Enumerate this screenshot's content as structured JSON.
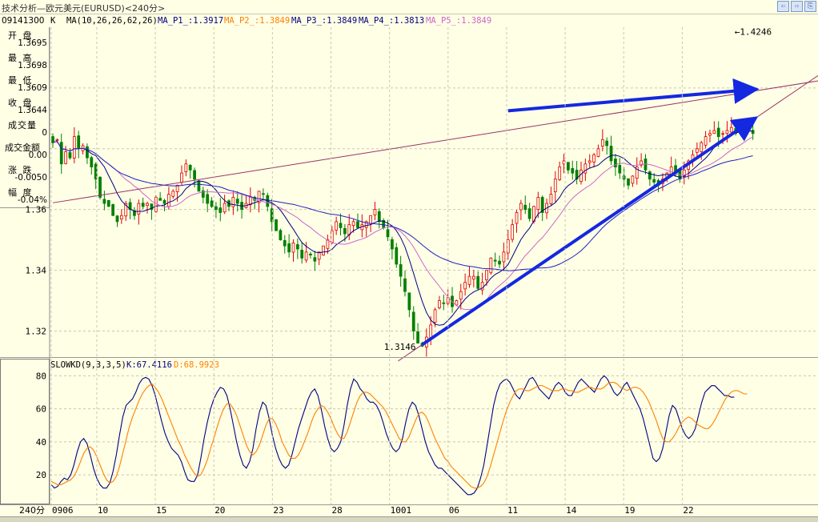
{
  "window": {
    "title": "技术分析—欧元美元(EURUSD)<240分>",
    "buttons": [
      "⇦",
      "⇨",
      "⎘"
    ]
  },
  "info": {
    "code": "09141300",
    "k_label": "K",
    "ma_params": "MA(10,26,26,62,26)",
    "ma": [
      {
        "label": "MA_P1_:1.3917",
        "color": "#000080"
      },
      {
        "label": "MA_P2_:1.3849",
        "color": "#ff8000"
      },
      {
        "label": "MA_P3_:1.3849",
        "color": "#000080"
      },
      {
        "label": "MA_P4_:1.3813",
        "color": "#000080"
      },
      {
        "label": "MA_P5_:1.3849",
        "color": "#cc66cc"
      }
    ]
  },
  "panel": [
    {
      "label": "开 盘",
      "value": "1.3695",
      "color": "#e00000"
    },
    {
      "label": "最 高",
      "value": "1.3698",
      "color": "#e00000"
    },
    {
      "label": "最 低",
      "value": "1.3609",
      "color": "#008000"
    },
    {
      "label": "收 盘",
      "value": "1.3644",
      "color": "#008000"
    },
    {
      "label": "成交量",
      "value": "0",
      "color": "#000000"
    },
    {
      "label": "成交金额",
      "value": "0.00",
      "color": "#000000"
    },
    {
      "label": "涨 跌",
      "value": "-0.0050",
      "color": "#008000"
    },
    {
      "label": "幅 度",
      "value": "-0.04%",
      "color": "#008000"
    }
  ],
  "chart_data": [
    {
      "type": "candlestick",
      "y_ticks": [
        "1.36",
        "1.34",
        "1.32"
      ],
      "ylim": [
        1.313,
        1.42
      ],
      "annotations": [
        {
          "text": "←1.4246",
          "at": "period high"
        },
        {
          "text": "1.3146",
          "at": "period low"
        }
      ],
      "trend_lines": [
        {
          "name": "resistance",
          "from": [
            0,
            1.3622
          ],
          "to": [
            170,
            1.4005
          ]
        },
        {
          "name": "upper arrow",
          "from": [
            106,
            1.3925
          ],
          "to": [
            163,
            1.3995
          ]
        },
        {
          "name": "lower arrow",
          "from": [
            86,
            1.3155
          ],
          "to": [
            163,
            1.3895
          ]
        }
      ],
      "close": [
        1.382,
        1.383,
        1.375,
        1.379,
        1.377,
        1.384,
        1.38,
        1.381,
        1.377,
        1.374,
        1.37,
        1.364,
        1.362,
        1.361,
        1.358,
        1.356,
        1.358,
        1.362,
        1.36,
        1.358,
        1.362,
        1.361,
        1.362,
        1.36,
        1.364,
        1.363,
        1.362,
        1.365,
        1.366,
        1.368,
        1.372,
        1.375,
        1.373,
        1.37,
        1.366,
        1.364,
        1.362,
        1.361,
        1.36,
        1.359,
        1.362,
        1.361,
        1.364,
        1.362,
        1.36,
        1.362,
        1.364,
        1.363,
        1.366,
        1.365,
        1.361,
        1.356,
        1.353,
        1.35,
        1.348,
        1.346,
        1.349,
        1.347,
        1.344,
        1.346,
        1.345,
        1.343,
        1.346,
        1.348,
        1.35,
        1.353,
        1.356,
        1.354,
        1.352,
        1.355,
        1.356,
        1.354,
        1.355,
        1.356,
        1.358,
        1.36,
        1.356,
        1.354,
        1.351,
        1.347,
        1.342,
        1.338,
        1.333,
        1.327,
        1.32,
        1.316,
        1.315,
        1.318,
        1.322,
        1.327,
        1.33,
        1.329,
        1.331,
        1.328,
        1.33,
        1.333,
        1.336,
        1.338,
        1.338,
        1.334,
        1.336,
        1.34,
        1.344,
        1.343,
        1.342,
        1.346,
        1.35,
        1.355,
        1.359,
        1.362,
        1.36,
        1.357,
        1.361,
        1.364,
        1.359,
        1.362,
        1.365,
        1.37,
        1.374,
        1.376,
        1.373,
        1.372,
        1.37,
        1.373,
        1.375,
        1.376,
        1.378,
        1.38,
        1.383,
        1.381,
        1.376,
        1.374,
        1.372,
        1.37,
        1.368,
        1.371,
        1.374,
        1.376,
        1.373,
        1.37,
        1.369,
        1.368,
        1.37,
        1.372,
        1.374,
        1.372,
        1.37,
        1.373,
        1.376,
        1.378,
        1.38,
        1.382,
        1.384,
        1.385,
        1.386,
        1.384,
        1.385,
        1.386,
        1.387,
        1.385,
        1.386,
        1.387,
        1.386,
        1.385
      ],
      "ma_lines": [
        {
          "name": "MA_P1_",
          "color": "#000080",
          "window": 8
        },
        {
          "name": "MA_P5_",
          "color": "#cc66cc",
          "window": 16
        },
        {
          "name": "MA_P4_",
          "color": "#2020c0",
          "window": 40
        }
      ]
    },
    {
      "type": "line",
      "title": "SLOWKD(9,3,3,5)",
      "legend": [
        {
          "label": "K:67.4116",
          "color": "#000080"
        },
        {
          "label": "D:68.9923",
          "color": "#ff8000"
        }
      ],
      "y_ticks": [
        "80",
        "60",
        "40",
        "20"
      ],
      "ylim": [
        5,
        85
      ],
      "x_ticks": [
        "0906",
        "10",
        "15",
        "20",
        "23",
        "28",
        "1001",
        "06",
        "11",
        "14",
        "19",
        "22"
      ],
      "x_tick_index": [
        0,
        14,
        32,
        50,
        68,
        86,
        104,
        122,
        140,
        158,
        176,
        194
      ],
      "n": 220,
      "series": [
        {
          "name": "K",
          "color": "#000080",
          "values": [
            14,
            12,
            13,
            16,
            18,
            17,
            20,
            26,
            34,
            40,
            42,
            39,
            32,
            24,
            18,
            14,
            12,
            12,
            15,
            22,
            32,
            44,
            55,
            62,
            64,
            66,
            70,
            75,
            78,
            79,
            78,
            74,
            68,
            60,
            52,
            45,
            40,
            36,
            34,
            32,
            28,
            22,
            17,
            16,
            16,
            20,
            30,
            42,
            52,
            60,
            66,
            70,
            73,
            72,
            68,
            60,
            50,
            40,
            32,
            26,
            24,
            28,
            36,
            48,
            58,
            64,
            62,
            54,
            44,
            36,
            30,
            26,
            24,
            26,
            32,
            40,
            48,
            54,
            60,
            66,
            70,
            72,
            68,
            60,
            50,
            42,
            36,
            34,
            36,
            40,
            50,
            62,
            72,
            78,
            76,
            72,
            70,
            66,
            64,
            64,
            62,
            58,
            52,
            45,
            40,
            36,
            34,
            36,
            42,
            52,
            60,
            64,
            62,
            56,
            48,
            40,
            34,
            30,
            26,
            24,
            24,
            22,
            20,
            18,
            16,
            14,
            12,
            10,
            8,
            8,
            9,
            12,
            18,
            26,
            38,
            50,
            62,
            70,
            75,
            77,
            78,
            76,
            72,
            68,
            66,
            70,
            74,
            78,
            79,
            76,
            72,
            70,
            68,
            66,
            70,
            74,
            76,
            74,
            70,
            68,
            68,
            72,
            76,
            78,
            76,
            74,
            72,
            70,
            74,
            78,
            80,
            78,
            74,
            70,
            68,
            70,
            74,
            76,
            72,
            68,
            64,
            60,
            54,
            46,
            38,
            30,
            28,
            30,
            36,
            46,
            56,
            62,
            60,
            54,
            48,
            44,
            42,
            44,
            48,
            56,
            64,
            70,
            72,
            74,
            74,
            72,
            70,
            68,
            68,
            67,
            67
          ]
        },
        {
          "name": "D",
          "color": "#ff8000",
          "values": [
            16,
            15,
            14,
            14,
            15,
            16,
            17,
            19,
            23,
            28,
            33,
            36,
            37,
            35,
            31,
            26,
            21,
            17,
            15,
            16,
            19,
            25,
            33,
            41,
            49,
            55,
            60,
            65,
            69,
            72,
            74,
            75,
            73,
            70,
            66,
            61,
            56,
            51,
            46,
            41,
            37,
            32,
            28,
            24,
            21,
            19,
            20,
            24,
            29,
            36,
            42,
            49,
            55,
            60,
            63,
            63,
            60,
            56,
            50,
            44,
            38,
            34,
            32,
            34,
            38,
            44,
            50,
            54,
            54,
            51,
            46,
            40,
            36,
            32,
            30,
            30,
            32,
            36,
            41,
            46,
            52,
            57,
            60,
            62,
            61,
            58,
            54,
            49,
            45,
            42,
            42,
            46,
            52,
            58,
            64,
            68,
            70,
            70,
            69,
            67,
            65,
            63,
            61,
            58,
            54,
            50,
            46,
            42,
            40,
            40,
            43,
            48,
            53,
            57,
            58,
            56,
            52,
            47,
            42,
            38,
            34,
            30,
            28,
            25,
            23,
            21,
            19,
            17,
            15,
            13,
            12,
            12,
            13,
            15,
            19,
            25,
            32,
            39,
            46,
            53,
            59,
            64,
            68,
            71,
            72,
            72,
            71,
            71,
            72,
            73,
            74,
            74,
            73,
            72,
            71,
            71,
            71,
            72,
            72,
            71,
            71,
            70,
            70,
            71,
            72,
            73,
            73,
            72,
            72,
            72,
            73,
            75,
            76,
            76,
            75,
            73,
            72,
            71,
            72,
            73,
            73,
            72,
            70,
            67,
            63,
            58,
            53,
            47,
            42,
            40,
            40,
            42,
            45,
            49,
            52,
            54,
            55,
            54,
            52,
            50,
            49,
            48,
            48,
            50,
            53,
            57,
            61,
            65,
            68,
            70,
            71,
            71,
            70,
            69,
            69
          ]
        }
      ]
    }
  ]
}
